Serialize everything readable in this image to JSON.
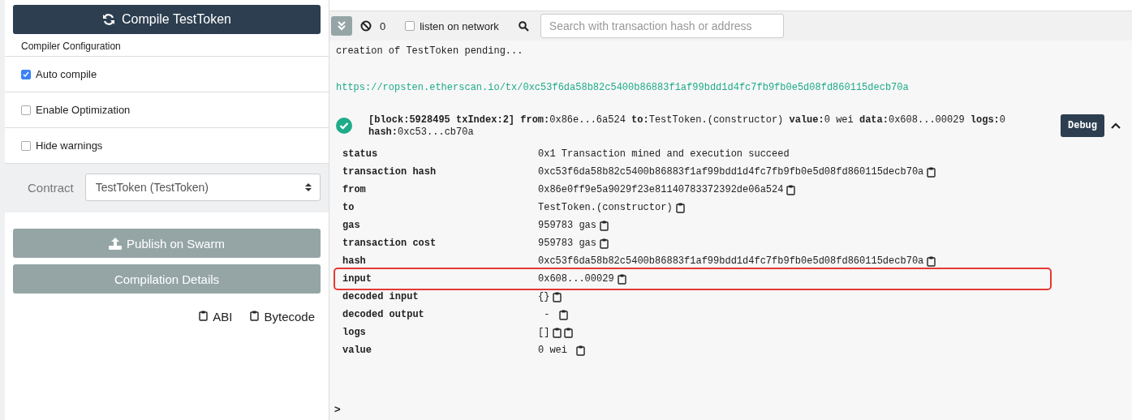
{
  "compiler": {
    "compile_button": "Compile TestToken",
    "config_title": "Compiler Configuration",
    "options": [
      {
        "label": "Auto compile",
        "checked": true
      },
      {
        "label": "Enable Optimization",
        "checked": false
      },
      {
        "label": "Hide warnings",
        "checked": false
      }
    ],
    "contract_label": "Contract",
    "contract_value": "TestToken (TestToken)",
    "publish_button": "Publish on Swarm",
    "details_button": "Compilation Details",
    "copy_links": [
      "ABI",
      "Bytecode"
    ]
  },
  "terminal": {
    "count": "0",
    "listen_label": "listen on network",
    "listen_checked": false,
    "search_placeholder": "Search with transaction hash or address",
    "pending": "creation of TestToken pending...",
    "link": "https://ropsten.etherscan.io/tx/0xc53f6da58b82c5400b86883f1af99bdd1d4fc7fb9fb0e5d08fd860115decb70a",
    "summary": "**[block:5928495 txIndex:2]** **from:**0x86e...6a524 **to:**TestToken.(constructor) **value:**0 wei **data:**0x608...00029 **logs:**0 **hash:**0xc53...cb70a",
    "success": true,
    "debug_button": "Debug",
    "expanded": true,
    "details": [
      {
        "key": "status",
        "value": "0x1 Transaction mined and execution succeed",
        "highlighted": false
      },
      {
        "key": "transaction hash",
        "value": "0xc53f6da58b82c5400b86883f1af99bdd1d4fc7fb9fb0e5d08fd860115decb70a",
        "highlighted": false,
        "copy_buttons": [
          {
            "kind": "clipboard"
          }
        ]
      },
      {
        "key": "from",
        "value": "0x86e0ff9e5a9029f23e81140783372392de06a524",
        "highlighted": false,
        "copy_buttons": [
          {
            "kind": "clipboard"
          }
        ]
      },
      {
        "key": "to",
        "value": "TestToken.(constructor)",
        "highlighted": false,
        "copy_buttons": [
          {
            "kind": "clipboard"
          }
        ]
      },
      {
        "key": "gas",
        "value": "959783 gas",
        "highlighted": false,
        "copy_buttons": [
          {
            "kind": "clipboard"
          }
        ]
      },
      {
        "key": "transaction cost",
        "value": "959783 gas",
        "highlighted": false,
        "copy_buttons": [
          {
            "kind": "clipboard"
          }
        ]
      },
      {
        "key": "hash",
        "value": "0xc53f6da58b82c5400b86883f1af99bdd1d4fc7fb9fb0e5d08fd860115decb70a",
        "highlighted": false,
        "copy_buttons": [
          {
            "kind": "clipboard"
          }
        ]
      },
      {
        "key": "input",
        "value": "0x608...00029",
        "highlighted": true,
        "copy_buttons": [
          {
            "kind": "clipboard"
          }
        ]
      },
      {
        "key": "decoded input",
        "value": "{}",
        "highlighted": false,
        "copy_buttons": [
          {
            "kind": "clipboard"
          }
        ]
      },
      {
        "key": "decoded output",
        "value": " - ",
        "highlighted": false,
        "copy_buttons": [
          {
            "kind": "clipboard"
          }
        ]
      },
      {
        "key": "logs",
        "value": "[]",
        "highlighted": false,
        "copy_buttons": [
          {
            "kind": "clipboard"
          },
          {
            "kind": "clipboard"
          }
        ]
      },
      {
        "key": "value",
        "value": "0 wei ",
        "highlighted": false,
        "copy_buttons": [
          {
            "kind": "clipboard"
          }
        ]
      }
    ],
    "prompt": ">"
  }
}
